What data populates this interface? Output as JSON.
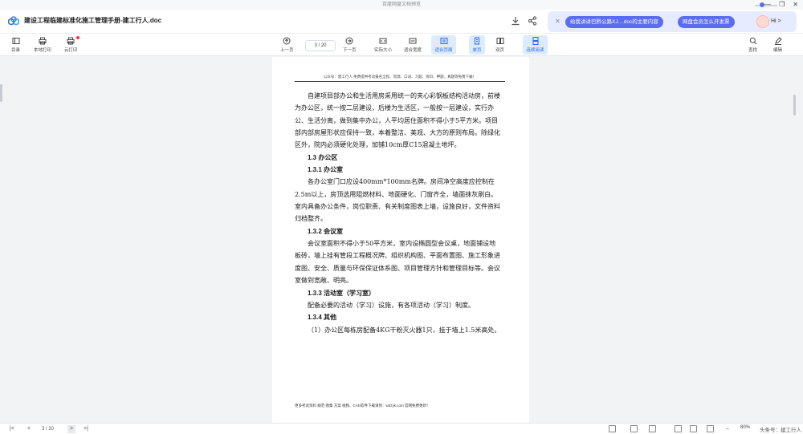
{
  "window": {
    "title": "百度网盘文档预览"
  },
  "header": {
    "doc_title": "建设工程临建标准化施工管理手册-建工行人.doc"
  },
  "ai_banner": {
    "pill1": "给我讲讲巴黔公路XJ....doc的主要内容",
    "pill2": "网盘会员怎么开发票",
    "greeting": "Hi >"
  },
  "toolbar": {
    "catalog": "目录",
    "local_print": "本地打印",
    "cloud_print": "云打印",
    "prev": "上一页",
    "page_indicator": "3 / 20",
    "next": "下一页",
    "actual_size": "实际大小",
    "fit_width": "适合宽度",
    "fit_page": "适合页面",
    "single_page": "单页",
    "double_page": "双页",
    "continuous": "连续阅读",
    "find": "查找",
    "edit": "编辑"
  },
  "page": {
    "header": "公众号：建工行人 免费提供考试报名全程、资源、口诀、习题、资料、押题、真题等免费下载！",
    "paragraphs": [
      {
        "type": "body",
        "text": "自建项目部办公和生活用房采用统一的夹心彩钢板结构活动房，前楼为办公区，统一按二层建设，后楼为生活区，一般按一层建设，实行办公、生活分离，做到集中办公，人平均居住面积不得小于5平方米。项目部内部房屋形状应保持一致，本着整洁、美观、大方的原则布局。除绿化区外，院内必须硬化处理，加铺10cm厚C15混凝土地坪。"
      },
      {
        "type": "heading",
        "text": "1.3 办公区"
      },
      {
        "type": "heading",
        "text": "1.3.1 办公室"
      },
      {
        "type": "body",
        "text": "各办公室门口应设400mm*100mm名牌。房间净空高度应控制在2.5m以上，房顶选用阻燃材料、地面硬化、门窗齐全，墙面抹灰刷白。室内具备办公条件，岗位职责、有关制度图表上墙，设施良好，文件资料归档整齐。"
      },
      {
        "type": "heading",
        "text": "1.3.2 会议室"
      },
      {
        "type": "body",
        "text": "会议室面积不得小于50平方米，室内设椭圆型会议桌，地面铺设地板砖，墙上挂有管段工程概况牌、组织机构图、平面布置图、施工形象进度图、安全、质量与环保保证体系图、项目管理方针和管理目标等。会议室做到宽敞、明亮。"
      },
      {
        "type": "heading",
        "text": "1.3.3 活动室（学习室）"
      },
      {
        "type": "body",
        "text": "配备必要的活动（学习）设施，有各项活动（学习）制度。"
      },
      {
        "type": "heading",
        "text": "1.3.4 其他"
      },
      {
        "type": "body",
        "text": "（1）办公区每栋房配备4KG干粉灭火器1只，挂于墙上1.5米高处。"
      }
    ],
    "footer": "更多考试资料 规范 图集 方案 视频、CAD软件下载请到：wdzyk.com 官网免费更新！"
  },
  "statusbar": {
    "page_indicator": "3 / 20",
    "zoom": "80%",
    "watermark": "头条号：建工行人"
  }
}
